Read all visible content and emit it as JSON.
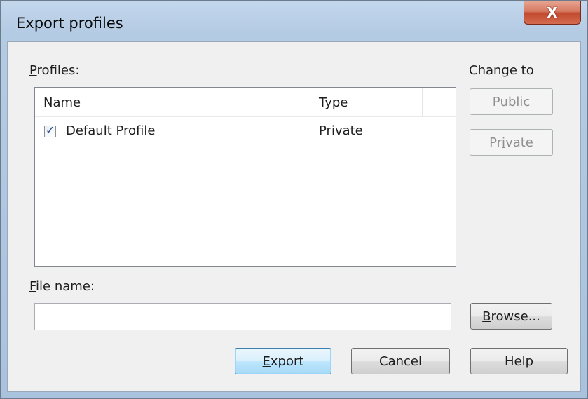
{
  "window": {
    "title": "Export profiles",
    "close_glyph": "X"
  },
  "profiles": {
    "label": "Profiles:",
    "label_access_key": "P",
    "label_rest": "rofiles:",
    "columns": [
      "Name",
      "Type"
    ],
    "rows": [
      {
        "checked": true,
        "name": "Default Profile",
        "type": "Private"
      }
    ]
  },
  "change_to": {
    "label": "Change to",
    "public_button": {
      "pre": "P",
      "key": "u",
      "post": "blic",
      "enabled": false
    },
    "private_button": {
      "pre": "Pr",
      "key": "i",
      "post": "vate",
      "enabled": false
    }
  },
  "file_name": {
    "label_access_key": "F",
    "label_rest": "ile name:",
    "value": "",
    "placeholder": ""
  },
  "buttons": {
    "browse": {
      "key": "B",
      "post": "rowse..."
    },
    "export": {
      "key": "E",
      "post": "xport"
    },
    "cancel": "Cancel",
    "help": "Help"
  },
  "colors": {
    "close_button": "#c24b2f",
    "default_button_border": "#3c7fb1",
    "dialog_face": "#f0f0f0",
    "frame": "#b4cbe4"
  },
  "icons": [
    "close-icon",
    "checkbox-checked-icon"
  ]
}
